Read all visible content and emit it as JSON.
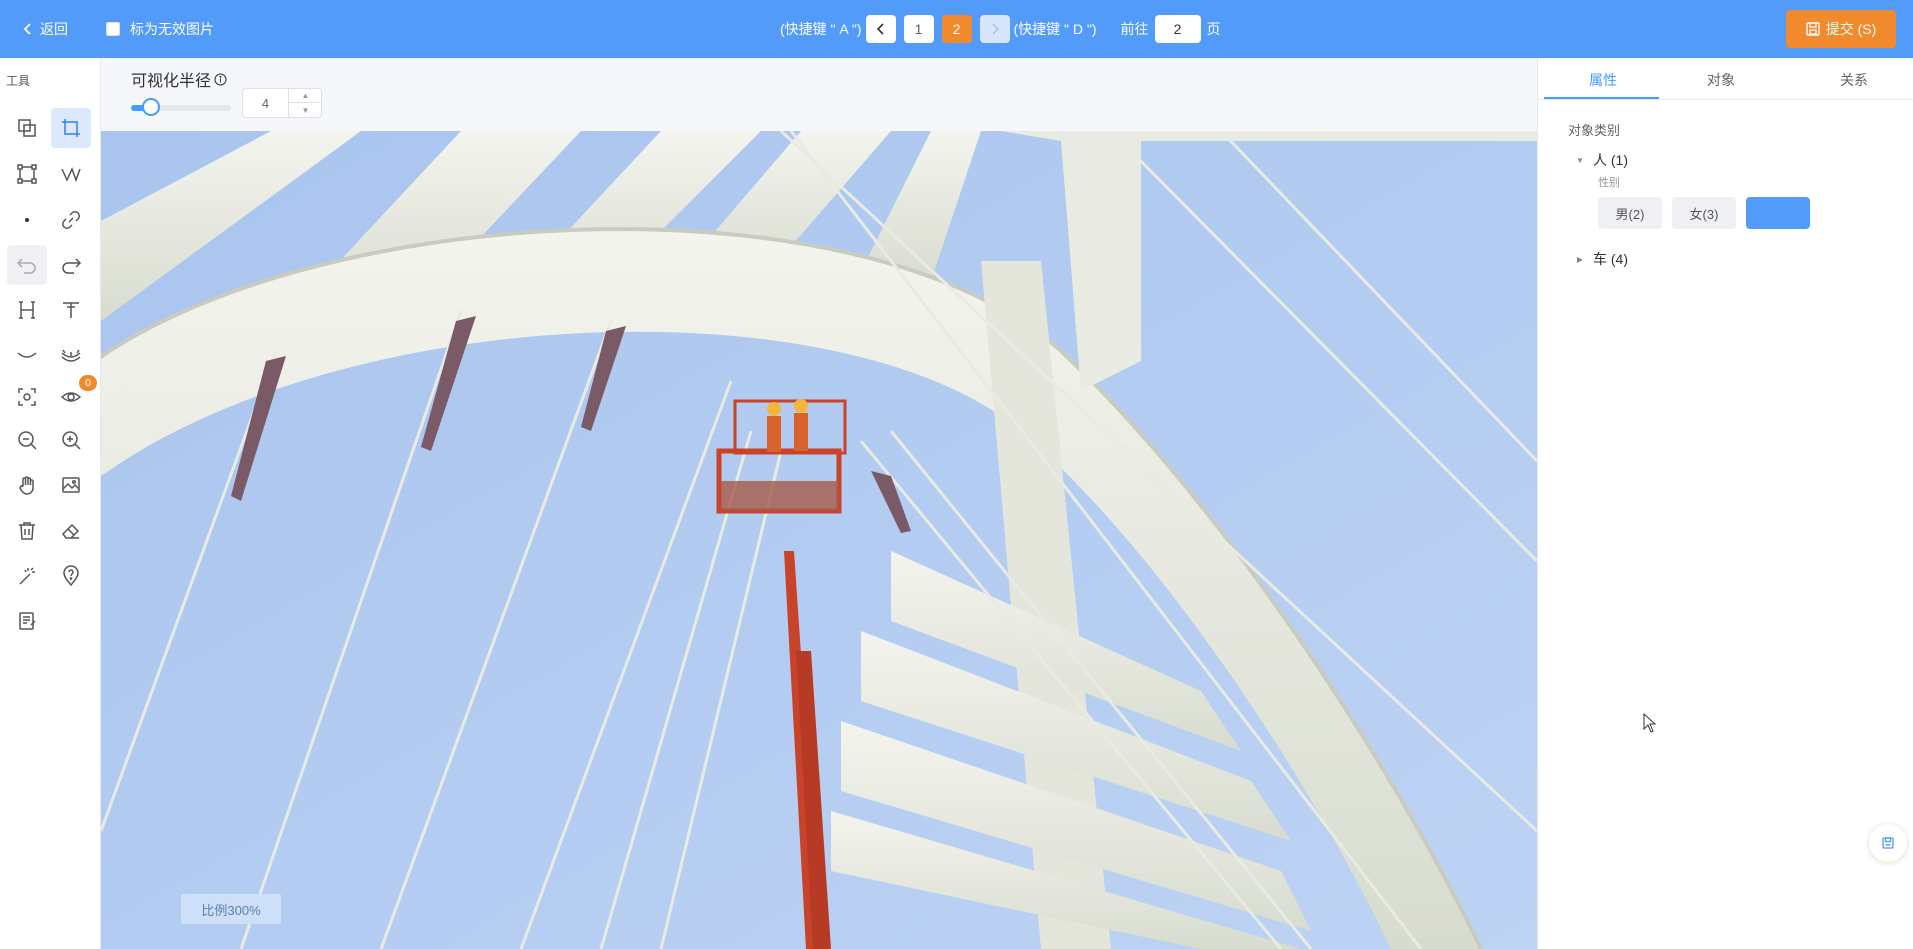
{
  "header": {
    "back_label": "返回",
    "invalid_label": "标为无效图片",
    "prev_hint": "(快捷键 \" A \")",
    "next_hint": "(快捷键 \" D \")",
    "pages": [
      "1",
      "2"
    ],
    "current_page": "2",
    "goto_prefix": "前往",
    "goto_value": "2",
    "goto_suffix": "页",
    "submit_label": "提交 (S)"
  },
  "toolbar": {
    "title": "工具",
    "tools": [
      "copy-shape",
      "rect-select",
      "bounding-box",
      "polyline",
      "point",
      "link",
      "undo",
      "redo",
      "height-marker",
      "text-marker",
      "curve",
      "eyelashes",
      "focus",
      "visibility",
      "zoom-out",
      "zoom-in",
      "pan",
      "image",
      "delete",
      "eraser",
      "magic-wand",
      "help",
      "notes"
    ],
    "visibility_badge": "0"
  },
  "control": {
    "radius_label": "可视化半径",
    "radius_value": "4",
    "slider_percent": 20
  },
  "canvas": {
    "scale_label": "比例300%"
  },
  "panel": {
    "tabs": [
      "属性",
      "对象",
      "关系"
    ],
    "active_tab": "属性",
    "category_title": "对象类别",
    "person_label": "人 (1)",
    "attr_label": "性别",
    "chips": [
      "男(2)",
      "女(3)",
      ""
    ],
    "car_label": "车 (4)"
  },
  "colors": {
    "header_bg": "#529bf9",
    "accent_orange": "#f08a2c",
    "primary_blue": "#409eff"
  }
}
